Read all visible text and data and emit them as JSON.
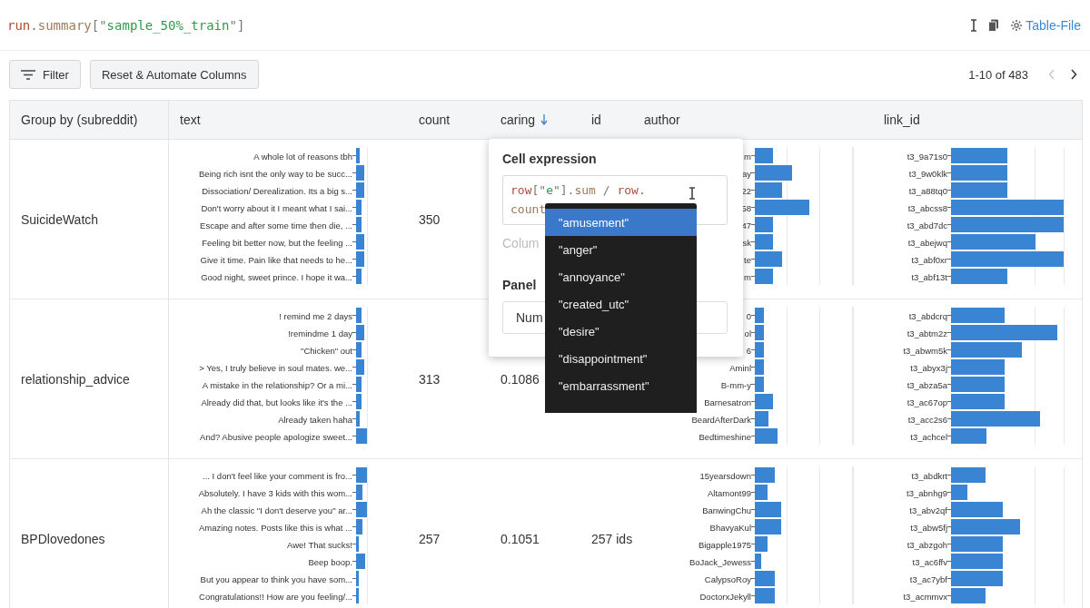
{
  "expression": [
    {
      "text": "run",
      "kind": "var"
    },
    {
      "text": ".",
      "kind": "punct"
    },
    {
      "text": "summary",
      "kind": "prop"
    },
    {
      "text": "[\"",
      "kind": "punct"
    },
    {
      "text": "sample_50%_train",
      "kind": "string"
    },
    {
      "text": "\"]",
      "kind": "punct"
    }
  ],
  "table_file_link": "Table-File",
  "toolbar": {
    "filter": "Filter",
    "reset": "Reset & Automate Columns",
    "pagination": "1-10 of 483",
    "prev_disabled": true,
    "next_disabled": false
  },
  "columns": [
    {
      "label": "Group by (subreddit)",
      "sorted": false
    },
    {
      "label": "text",
      "sorted": false
    },
    {
      "label": "count",
      "sorted": false
    },
    {
      "label": "caring",
      "sorted": true
    },
    {
      "label": "id",
      "sorted": false
    },
    {
      "label": "author",
      "sorted": false
    },
    {
      "label": "link_id",
      "sorted": false
    }
  ],
  "rows": [
    {
      "group": "SuicideWatch",
      "text_labels": [
        "A whole lot of reasons tbh",
        "Being rich isnt the only way to be succ...",
        "Dissociation/ Derealization. Its a big s...",
        "Don't worry about it I meant what I sai...",
        "Escape and after some time then die, ...",
        "Feeling bit better now, but the feeling ...",
        "Give it time. Pain like that needs to he...",
        "Good night, sweet prince. I hope it wa..."
      ],
      "count": "350",
      "author_labels": [
        "m",
        "ay",
        "22",
        "58",
        "47",
        "sk",
        "te",
        "m"
      ],
      "link_labels": [
        "t3_9a71s0",
        "t3_9w0klk",
        "t3_a88tq0",
        "t3_abcss8",
        "t3_abd7dc",
        "t3_abejwq",
        "t3_abf0xr",
        "t3_abf13t"
      ]
    },
    {
      "group": "relationship_advice",
      "text_labels": [
        "! remind me 2 days",
        "!remindme 1 day",
        "\"Chicken\" out",
        "> Yes, I truly believe in soul mates. we...",
        "A mistake in the relationship? Or a mi...",
        "Already did that, but looks like it's the ...",
        "Already taken haha",
        "And? Abusive people apologize sweet..."
      ],
      "count": "313",
      "caring": "0.1086",
      "author_labels": [
        "0",
        "ol",
        "6",
        "Aminl",
        "B-mm-y",
        "Barnesatron",
        "BeardAfterDark",
        "Bedtimeshine"
      ],
      "link_labels": [
        "t3_abdcrq",
        "t3_abtm2z",
        "t3_abwm5k",
        "t3_abyx3j",
        "t3_abza5a",
        "t3_ac67op",
        "t3_acc2s6",
        "t3_achcel"
      ]
    },
    {
      "group": "BPDlovedones",
      "text_labels": [
        "... I don't feel like your comment is fro...",
        "Absolutely. I have 3 kids with this wom...",
        "Ah the classic \"I don't deserve you\" ar...",
        "Amazing notes. Posts like this is what ...",
        "Awe! That sucks!",
        "Beep boop.",
        "But you appear to think you have som...",
        "Congratulations!! How are you feeling/..."
      ],
      "count": "257",
      "caring": "0.1051",
      "id": "257 ids",
      "author_labels": [
        "15yearsdown",
        "Altamont99",
        "BanwingChu",
        "BhavyaKul",
        "Bigapple1975",
        "BoJack_Jewess",
        "CalypsoRoy",
        "DoctorxJekyll"
      ],
      "link_labels": [
        "t3_abdkrt",
        "t3_abnhg9",
        "t3_abv2qf",
        "t3_abw5fj",
        "t3_abzgoh",
        "t3_ac6ffv",
        "t3_ac7ybf",
        "t3_acmmvx"
      ]
    }
  ],
  "popup": {
    "title": "Cell expression",
    "editor_lines": [
      [
        {
          "text": "row",
          "kind": "var"
        },
        {
          "text": "[\"",
          "kind": "punct"
        },
        {
          "text": "e",
          "kind": "string"
        },
        {
          "text": "\"].",
          "kind": "punct"
        },
        {
          "text": "sum",
          "kind": "prop"
        },
        {
          "text": " / ",
          "kind": "punct"
        },
        {
          "text": "row.",
          "kind": "var"
        }
      ],
      [
        {
          "text": "count",
          "kind": "prop"
        }
      ]
    ],
    "column_hint": "Colum",
    "panel_label": "Panel",
    "panel_value": "Num"
  },
  "suggestions": [
    {
      "label": "\"amusement\"",
      "selected": true
    },
    {
      "label": "\"anger\"",
      "selected": false
    },
    {
      "label": "\"annoyance\"",
      "selected": false
    },
    {
      "label": "\"created_utc\"",
      "selected": false
    },
    {
      "label": "\"desire\"",
      "selected": false
    },
    {
      "label": "\"disappointment\"",
      "selected": false
    },
    {
      "label": "\"embarrassment\"",
      "selected": false
    }
  ]
}
